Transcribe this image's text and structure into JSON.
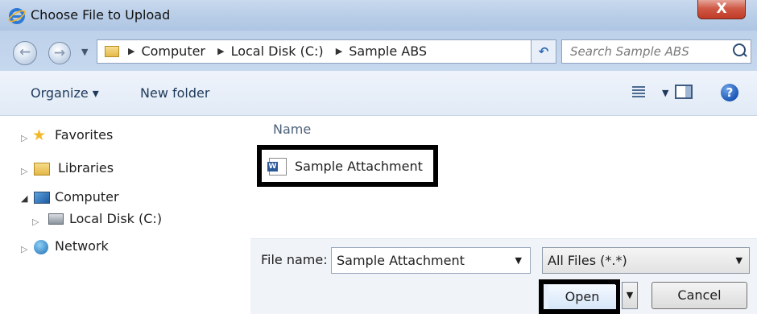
{
  "window": {
    "title": "Choose File to Upload",
    "close_glyph": "X"
  },
  "address_bar": {
    "breadcrumbs": [
      "Computer",
      "Local Disk (C:)",
      "Sample ABS"
    ]
  },
  "search": {
    "placeholder": "Search Sample ABS"
  },
  "toolbar": {
    "organize_label": "Organize ▾",
    "new_folder_label": "New folder"
  },
  "nav_pane": {
    "items": [
      {
        "label": "Favorites",
        "icon": "star-icon",
        "expanded": false
      },
      {
        "label": "Libraries",
        "icon": "libraries-icon",
        "expanded": false
      },
      {
        "label": "Computer",
        "icon": "computer-icon",
        "expanded": true
      },
      {
        "label": "Local Disk (C:)",
        "icon": "disk-icon",
        "expanded": false
      },
      {
        "label": "Network",
        "icon": "network-icon",
        "expanded": false
      }
    ]
  },
  "file_list": {
    "column_header": "Name",
    "files": [
      {
        "name": "Sample Attachment",
        "icon": "word-document-icon",
        "highlighted": true
      }
    ]
  },
  "file_name": {
    "label": "File name:",
    "value": "Sample Attachment"
  },
  "file_type": {
    "value": "All Files (*.*)"
  },
  "buttons": {
    "open_label": "Open",
    "cancel_label": "Cancel"
  },
  "colors": {
    "highlight_border": "#000000",
    "titlebar": "#b8cde7",
    "close_button": "#c13a26"
  }
}
